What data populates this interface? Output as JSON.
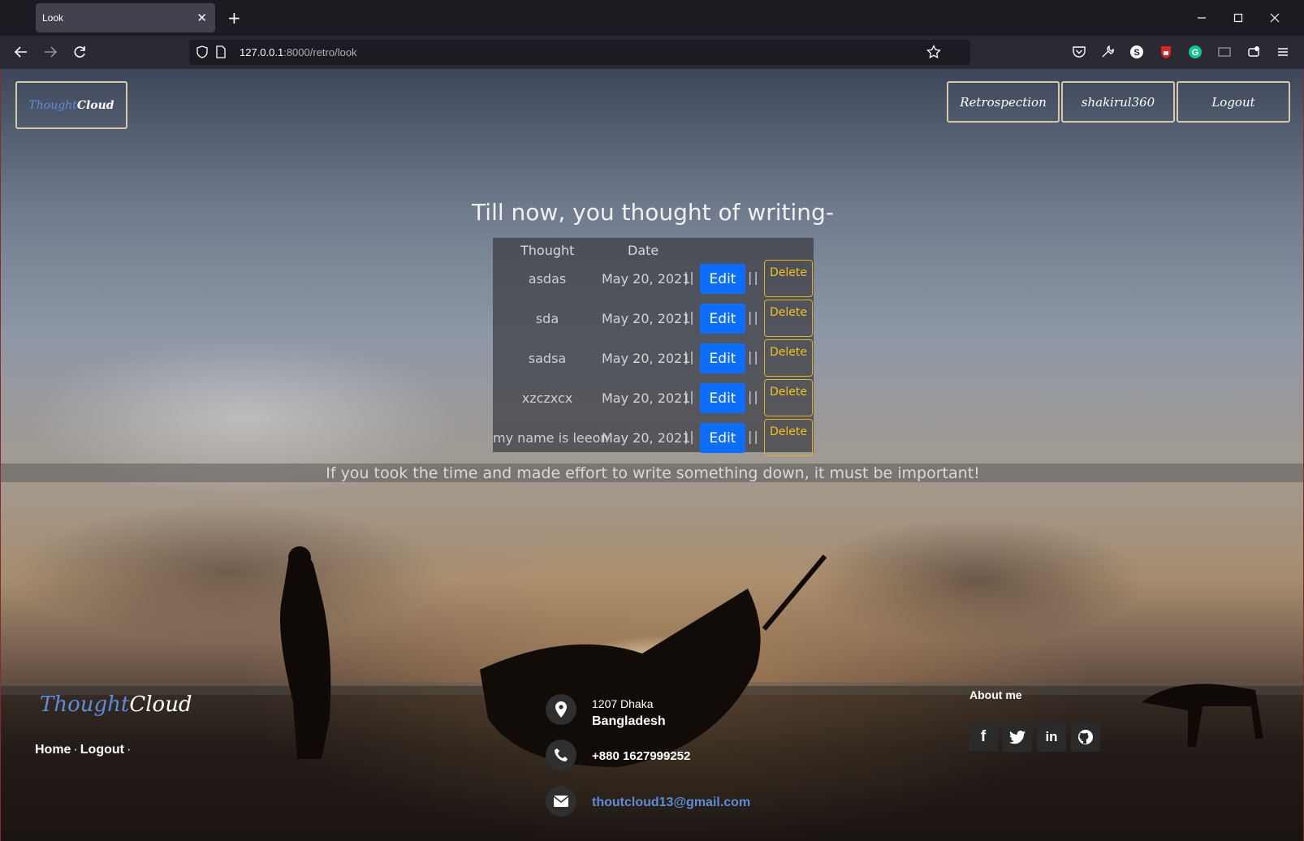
{
  "browser": {
    "tab_title": "Look",
    "tab_close": "✕",
    "new_tab": "+",
    "url_host": "127.0.0.1",
    "url_rest": ":8000/retro/look"
  },
  "header": {
    "logo_thought": "Thought",
    "logo_cloud": "Cloud",
    "nav": {
      "retrospection": "Retrospection",
      "user": "shakirul360",
      "logout": "Logout"
    }
  },
  "main": {
    "heading": "Till now, you thought of writing-",
    "columns": {
      "thought": "Thought",
      "date": "Date"
    },
    "separator": "||",
    "edit_label": "Edit",
    "delete_label": "Delete",
    "rows": [
      {
        "thought": "asdas",
        "date": "May 20, 2021"
      },
      {
        "thought": "sda",
        "date": "May 20, 2021"
      },
      {
        "thought": "sadsa",
        "date": "May 20, 2021"
      },
      {
        "thought": "xzczxcx",
        "date": "May 20, 2021"
      },
      {
        "thought": "my name is leeon",
        "date": "May 20, 2021"
      }
    ],
    "banner": "If you took the time and made effort to write something down, it must be important!"
  },
  "footer": {
    "logo_thought": "Thought",
    "logo_cloud": "Cloud",
    "links": {
      "home": "Home",
      "logout": "Logout",
      "dot": "·"
    },
    "address_line1": "1207 Dhaka",
    "address_line2": "Bangladesh",
    "phone": "+880 1627999252",
    "email": "thoutcloud13@gmail.com",
    "about_title": "About me",
    "social": [
      "facebook-icon",
      "twitter-icon",
      "linkedin-icon",
      "github-icon"
    ],
    "email_color": "#5b8dd9"
  },
  "colors": {
    "edit_button": "#0d6efd",
    "delete_button": "#f5c317",
    "logo_accent": "#5b8dd9"
  }
}
